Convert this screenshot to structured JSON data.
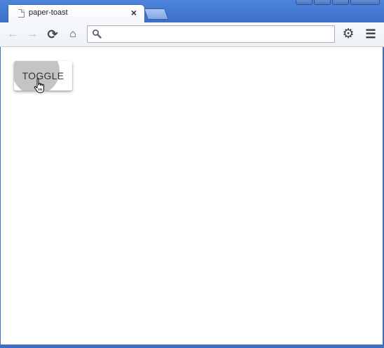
{
  "browser": {
    "tab": {
      "title": "paper-toast",
      "close_glyph": "×",
      "favicon": "page-icon"
    },
    "new_tab": "new-tab-icon",
    "window_controls": [
      "user-icon",
      "minimize-icon",
      "restore-icon",
      "close-icon"
    ],
    "toolbar": {
      "back": "←",
      "forward": "→",
      "reload": "⟳",
      "home": "⌂",
      "settings": "⚙",
      "menu": "☰"
    },
    "omnibox": {
      "value": "",
      "placeholder": ""
    }
  },
  "page": {
    "toggle_button_label": "TOGGLE"
  },
  "colors": {
    "tabstrip": "#4d83db",
    "ripple": "#a0a0a0"
  }
}
